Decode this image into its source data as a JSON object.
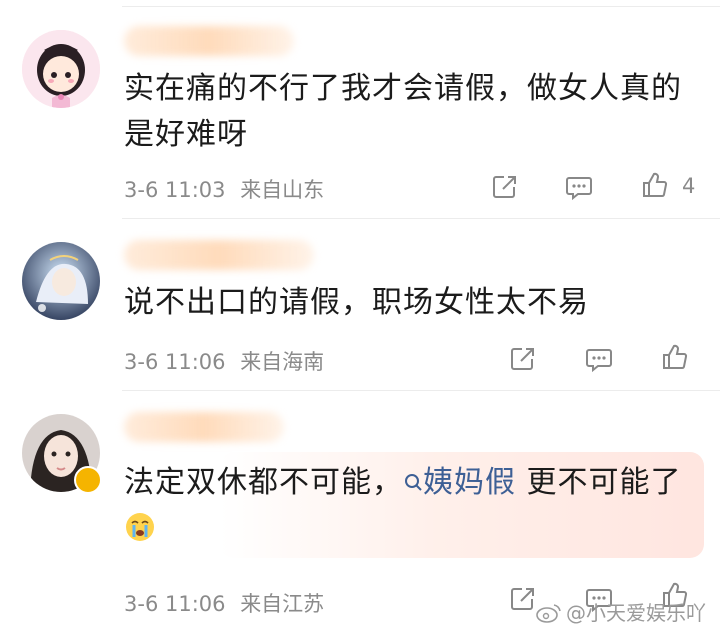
{
  "comments": [
    {
      "text": "实在痛的不行了我才会请假，做女人真的是好难呀",
      "time": "3-6 11:03",
      "location": "来自山东",
      "likes": "4"
    },
    {
      "text": "说不出口的请假，职场女性太不易",
      "time": "3-6 11:06",
      "location": "来自海南",
      "likes": ""
    },
    {
      "text_before": "法定双休都不可能，",
      "topic": "姨妈假",
      "text_after": " 更不可能了",
      "time": "3-6 11:06",
      "location": "来自江苏",
      "likes": ""
    }
  ],
  "watermark": "@小天爱娱乐吖",
  "icons": [
    "share-icon",
    "comment-icon",
    "like-icon",
    "topic-search-icon",
    "crying-emoji-icon",
    "verified-badge-icon",
    "weibo-logo-icon"
  ],
  "colors": {
    "topic": "#3d5f95",
    "meta": "#8a8a8a",
    "badge": "#f5b400"
  }
}
